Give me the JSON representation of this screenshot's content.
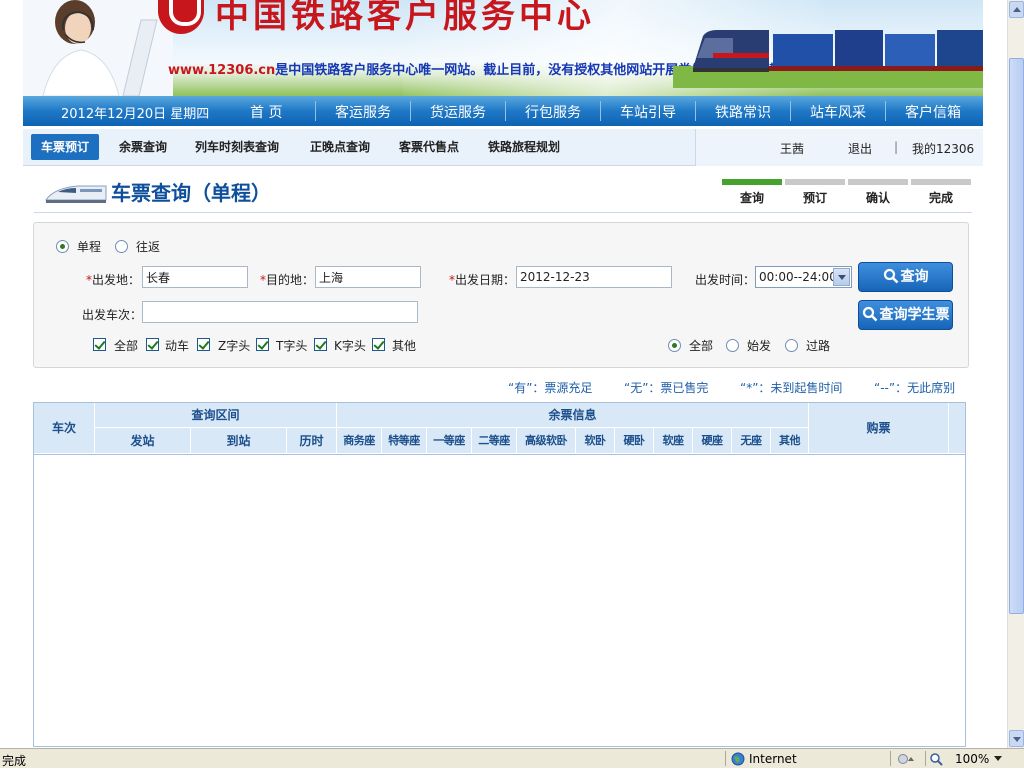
{
  "banner": {
    "title": "中国铁路客户服务中心",
    "url": "www.12306.cn",
    "notice": "是中国铁路客户服务中心唯一网站。截止目前，没有授权其他网站开展类似服务内容，敬请广大用户注意"
  },
  "mainnav": {
    "date": "2012年12月20日  星期四",
    "items": [
      "首 页",
      "客运服务",
      "货运服务",
      "行包服务",
      "车站引导",
      "铁路常识",
      "站车风采",
      "客户信箱"
    ]
  },
  "subnav": {
    "tabs": [
      "车票预订",
      "余票查询",
      "列车时刻表查询",
      "正晚点查询",
      "客票代售点",
      "铁路旅程规划"
    ],
    "user_name": "王茜",
    "logout": "退出",
    "separator": "|",
    "my_account": "我的12306"
  },
  "page": {
    "title": "车票查询（单程）",
    "steps": [
      "查询",
      "预订",
      "确认",
      "完成"
    ]
  },
  "form": {
    "trip_types": [
      "单程",
      "往返"
    ],
    "from_label": "出发地：",
    "from_value": "长春",
    "to_label": "目的地：",
    "to_value": "上海",
    "date_label": "出发日期：",
    "date_value": "2012-12-23",
    "time_label": "出发时间：",
    "time_value": "00:00--24:00",
    "train_no_label": "出发车次：",
    "train_no_value": "",
    "required_mark": "*",
    "train_types": [
      "全部",
      "动车",
      "Z字头",
      "T字头",
      "K字头",
      "其他"
    ],
    "station_types": [
      "全部",
      "始发",
      "过路"
    ],
    "search_button": "查询",
    "student_button": "查询学生票"
  },
  "legend": {
    "you": "“有”：票源充足",
    "wu": "“无”：票已售完",
    "star": "“*”：未到起售时间",
    "dash": "“--”：无此席别"
  },
  "table": {
    "train_no": "车次",
    "query_range": "查询区间",
    "from_station": "发站",
    "to_station": "到站",
    "duration": "历时",
    "seats_info": "余票信息",
    "seat_types": [
      "商务座",
      "特等座",
      "一等座",
      "二等座",
      "高级软卧",
      "软卧",
      "硬卧",
      "软座",
      "硬座",
      "无座",
      "其他"
    ],
    "buy": "购票"
  },
  "statusbar": {
    "text": "完成",
    "zone": "Internet",
    "zoom": "100%"
  }
}
